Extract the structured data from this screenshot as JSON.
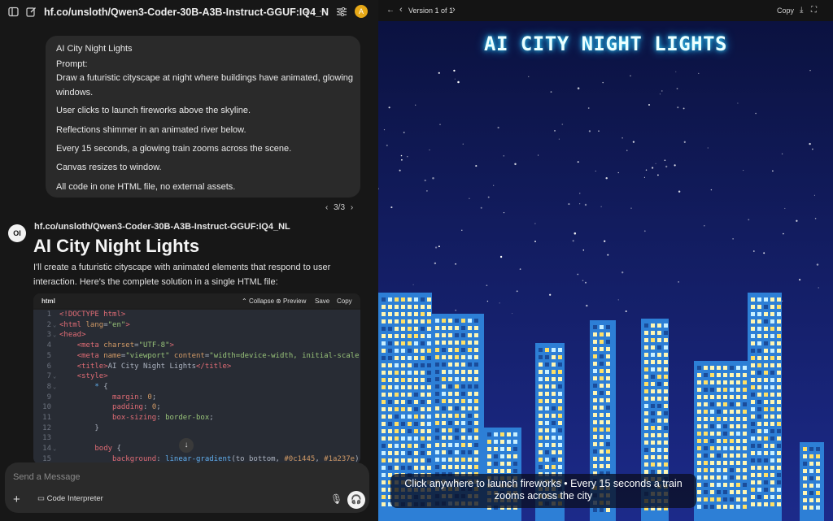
{
  "topbar": {
    "model_title": "hf.co/unsloth/Qwen3-Coder-30B-A3B-Instruct-GGUF:IQ4_N",
    "avatar_letter": "A",
    "icons": [
      "sidebar-icon",
      "edit-icon",
      "plus-icon",
      "more-icon",
      "controls-icon"
    ]
  },
  "user_message": {
    "lines": [
      "AI City Night Lights",
      "Prompt:",
      "Draw a futuristic cityscape at night where buildings have animated, glowing",
      "windows.",
      "User clicks to launch fireworks above the skyline.",
      "Reflections shimmer in an animated river below.",
      "Every 15 seconds, a glowing train zooms across the scene.",
      "Canvas resizes to window.",
      "All code in one HTML file, no external assets."
    ],
    "pager": "3/3"
  },
  "assistant": {
    "logo": "OI",
    "name": "hf.co/unsloth/Qwen3-Coder-30B-A3B-Instruct-GGUF:IQ4_NL",
    "heading": "AI City Night Lights",
    "intro": "I'll create a futuristic cityscape with animated elements that respond to user interaction. Here's the complete solution in a single HTML file:"
  },
  "codeblock": {
    "lang": "html",
    "actions": {
      "collapse": "Collapse",
      "preview": "Preview",
      "save": "Save",
      "copy": "Copy"
    },
    "lines": [
      {
        "n": "1",
        "fold": false,
        "text": "<!DOCTYPE html>"
      },
      {
        "n": "2",
        "fold": true,
        "text": "<html lang=\"en\">"
      },
      {
        "n": "3",
        "fold": true,
        "text": "<head>"
      },
      {
        "n": "4",
        "fold": false,
        "text": "    <meta charset=\"UTF-8\">"
      },
      {
        "n": "5",
        "fold": false,
        "text": "    <meta name=\"viewport\" content=\"width=device-width, initial-scale"
      },
      {
        "n": "6",
        "fold": false,
        "text": "    <title>AI City Night Lights</title>"
      },
      {
        "n": "7",
        "fold": true,
        "text": "    <style>"
      },
      {
        "n": "8",
        "fold": true,
        "text": "        * {"
      },
      {
        "n": "9",
        "fold": false,
        "text": "            margin: 0;"
      },
      {
        "n": "10",
        "fold": false,
        "text": "            padding: 0;"
      },
      {
        "n": "11",
        "fold": false,
        "text": "            box-sizing: border-box;"
      },
      {
        "n": "12",
        "fold": false,
        "text": "        }"
      },
      {
        "n": "13",
        "fold": false,
        "text": ""
      },
      {
        "n": "14",
        "fold": true,
        "text": "        body {"
      },
      {
        "n": "15",
        "fold": false,
        "text": "            background: linear-gradient(to bottom, #0c1445, #1a237e)"
      }
    ]
  },
  "composer": {
    "placeholder": "Send a Message",
    "code_interpreter": "Code Interpreter"
  },
  "preview": {
    "version_label": "Version 1 of 1",
    "copy": "Copy",
    "scene_title": "AI CITY NIGHT LIGHTS",
    "caption_line1": "Click anywhere to launch fireworks • Every 15 seconds a train",
    "caption_line2": "zooms across the city"
  },
  "colors": {
    "sky_top": "#0b1240",
    "sky_bottom": "#1c2a8a",
    "building": "#2d7fd6",
    "window_lit": "#fff6b3",
    "title_glow": "#33d6ff"
  }
}
